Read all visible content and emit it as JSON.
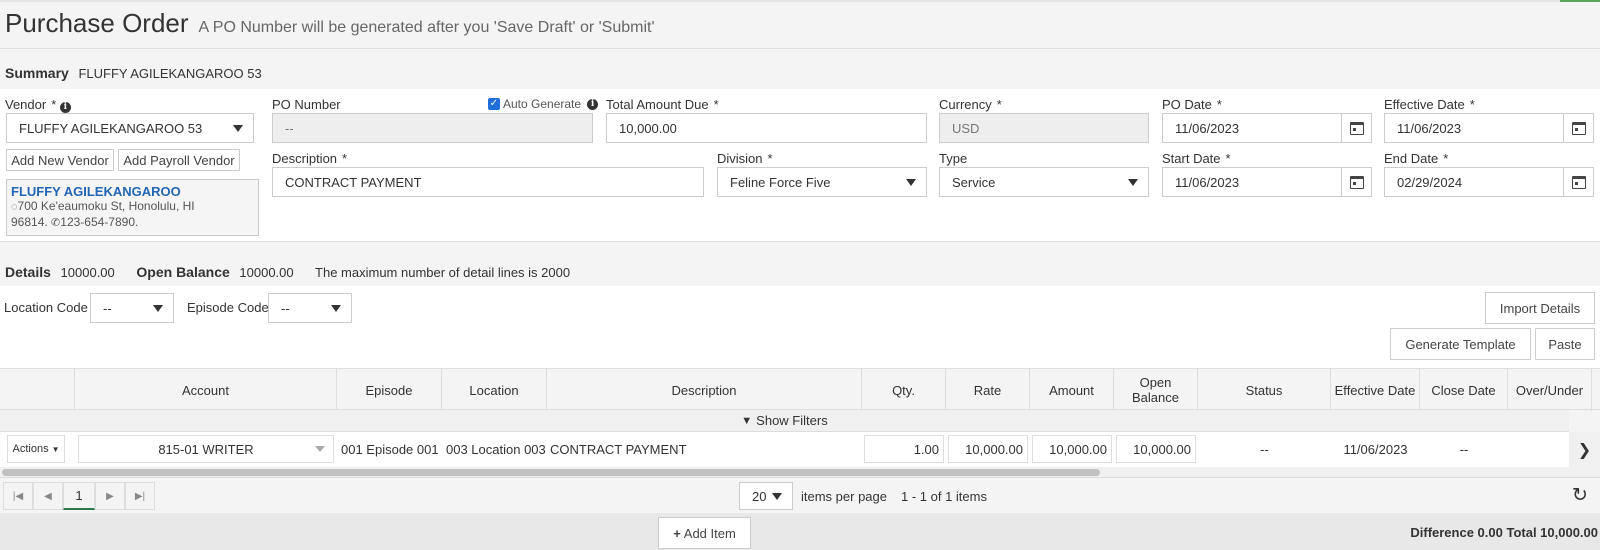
{
  "header": {
    "title": "Purchase Order",
    "subtitle": "A PO Number will be generated after you 'Save Draft' or 'Submit'"
  },
  "summary": {
    "label": "Summary",
    "vendor_name": "FLUFFY AGILEKANGAROO 53"
  },
  "form": {
    "vendor_label": "Vendor",
    "vendor_value": "FLUFFY AGILEKANGAROO 53",
    "add_new_vendor": "Add New Vendor",
    "add_payroll_vendor": "Add Payroll Vendor",
    "vendor_card": {
      "name": "FLUFFY AGILEKANGAROO",
      "address_line1": "700 Ke'eaumoku St,   Honolulu,  HI",
      "address_line2": "96814.",
      "phone": "123-654-7890."
    },
    "po_number_label": "PO Number",
    "po_number_value": "--",
    "auto_generate_label": "Auto Generate",
    "total_amount_label": "Total Amount Due",
    "total_amount_value": "10,000.00",
    "currency_label": "Currency",
    "currency_value": "USD",
    "po_date_label": "PO Date",
    "po_date_value": "11/06/2023",
    "effective_date_label": "Effective Date",
    "effective_date_value": "11/06/2023",
    "description_label": "Description",
    "description_value": "CONTRACT PAYMENT",
    "division_label": "Division",
    "division_value": "Feline Force Five",
    "type_label": "Type",
    "type_value": "Service",
    "start_date_label": "Start Date",
    "start_date_value": "11/06/2023",
    "end_date_label": "End Date",
    "end_date_value": "02/29/2024",
    "required_mark": "*"
  },
  "details": {
    "label": "Details",
    "amount": "10000.00",
    "open_balance_label": "Open Balance",
    "open_balance": "10000.00",
    "note": "The maximum number of detail lines is 2000",
    "location_code_label": "Location Code",
    "location_code_value": "--",
    "episode_code_label": "Episode Code",
    "episode_code_value": "--",
    "import_details": "Import Details",
    "generate_template": "Generate Template",
    "paste": "Paste"
  },
  "grid": {
    "columns": [
      "Account",
      "Episode",
      "Location",
      "Description",
      "Qty.",
      "Rate",
      "Amount",
      "Open Balance",
      "Status",
      "Effective Date",
      "Close Date",
      "Over/Under"
    ],
    "show_filters": "Show Filters",
    "row": {
      "actions": "Actions",
      "account": "815-01 WRITER",
      "episode": "001 Episode 001",
      "location": "003 Location 003",
      "description": "CONTRACT PAYMENT",
      "qty": "1.00",
      "rate": "10,000.00",
      "amount": "10,000.00",
      "open_balance": "10,000.00",
      "status": "--",
      "effective_date": "11/06/2023",
      "close_date": "--",
      "over_under": ""
    }
  },
  "pager": {
    "page": "1",
    "page_size": "20",
    "items_per_page": "items per page",
    "range": "1 - 1 of 1 items"
  },
  "footer": {
    "add_item": "Add Item",
    "totals": "Difference 0.00 Total 10,000.00"
  },
  "colors": {
    "accent_blue": "#2166b5",
    "checkbox_blue": "#1e6fd9",
    "green_line": "#5aa55a"
  }
}
